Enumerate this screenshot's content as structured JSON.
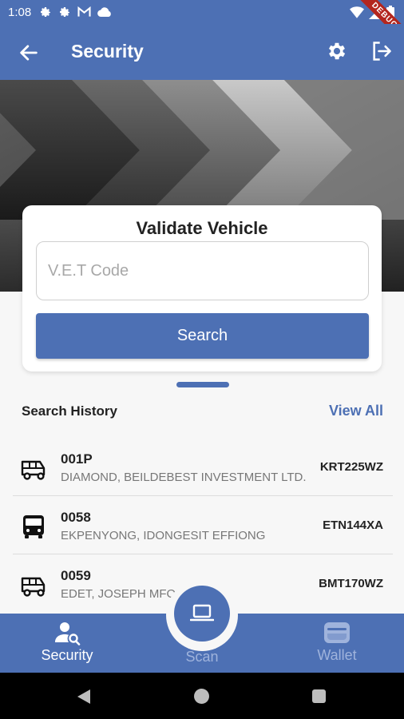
{
  "status_bar": {
    "time": "1:08",
    "debug_label": "DEBUG"
  },
  "app_bar": {
    "title": "Security"
  },
  "validate_card": {
    "title": "Validate Vehicle",
    "input_placeholder": "V.E.T Code",
    "input_value": "",
    "search_label": "Search"
  },
  "history": {
    "title": "Search History",
    "view_all_label": "View All",
    "rows": [
      {
        "icon": "tricycle-icon",
        "code": "001P",
        "owner": "DIAMOND, BEILDEBEST INVESTMENT LTD.",
        "plate": "KRT225WZ"
      },
      {
        "icon": "bus-icon",
        "code": "0058",
        "owner": "EKPENYONG, IDONGESIT EFFIONG",
        "plate": "ETN144XA"
      },
      {
        "icon": "tricycle-icon",
        "code": "0059",
        "owner": "EDET, JOSEPH MFON",
        "plate": "BMT170WZ"
      }
    ]
  },
  "bottom_nav": {
    "items": [
      {
        "label": "Security",
        "icon": "person-search-icon",
        "active": true
      },
      {
        "label": "Scan",
        "icon": "laptop-icon",
        "active": false
      },
      {
        "label": "Wallet",
        "icon": "wallet-icon",
        "active": false
      }
    ]
  },
  "colors": {
    "primary": "#4d70b4",
    "inactive_nav": "#9fb3dc"
  }
}
